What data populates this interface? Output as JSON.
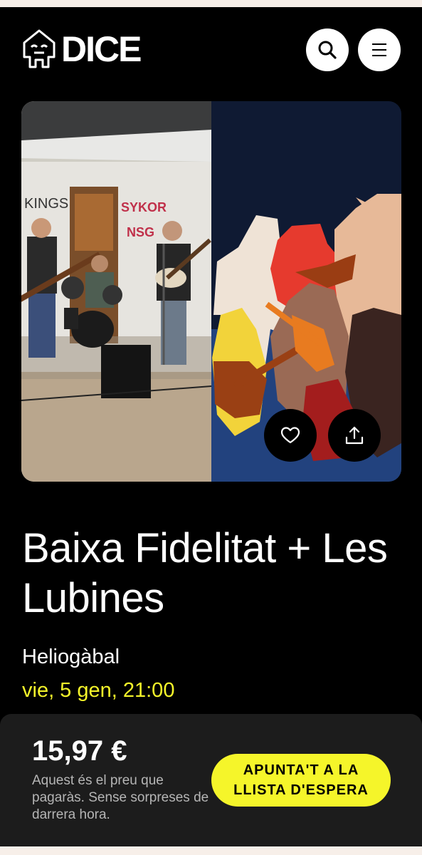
{
  "header": {
    "logo_text": "DICE",
    "search_icon": "search-icon",
    "menu_icon": "menu-icon"
  },
  "hero": {
    "like_icon": "heart-icon",
    "share_icon": "share-icon"
  },
  "event": {
    "title": "Baixa Fidelitat + Les Lubines",
    "venue": "Heliogàbal",
    "datetime": "vie, 5 gen, 21:00"
  },
  "purchase": {
    "price": "15,97 €",
    "price_note": "Aquest és el preu que pagaràs. Sense sorpreses de darrera hora.",
    "cta_label": "APUNTA'T A LA LLISTA D'ESPERA"
  },
  "colors": {
    "accent": "#f5f52a",
    "background": "#000000",
    "panel": "#1c1c1c"
  }
}
